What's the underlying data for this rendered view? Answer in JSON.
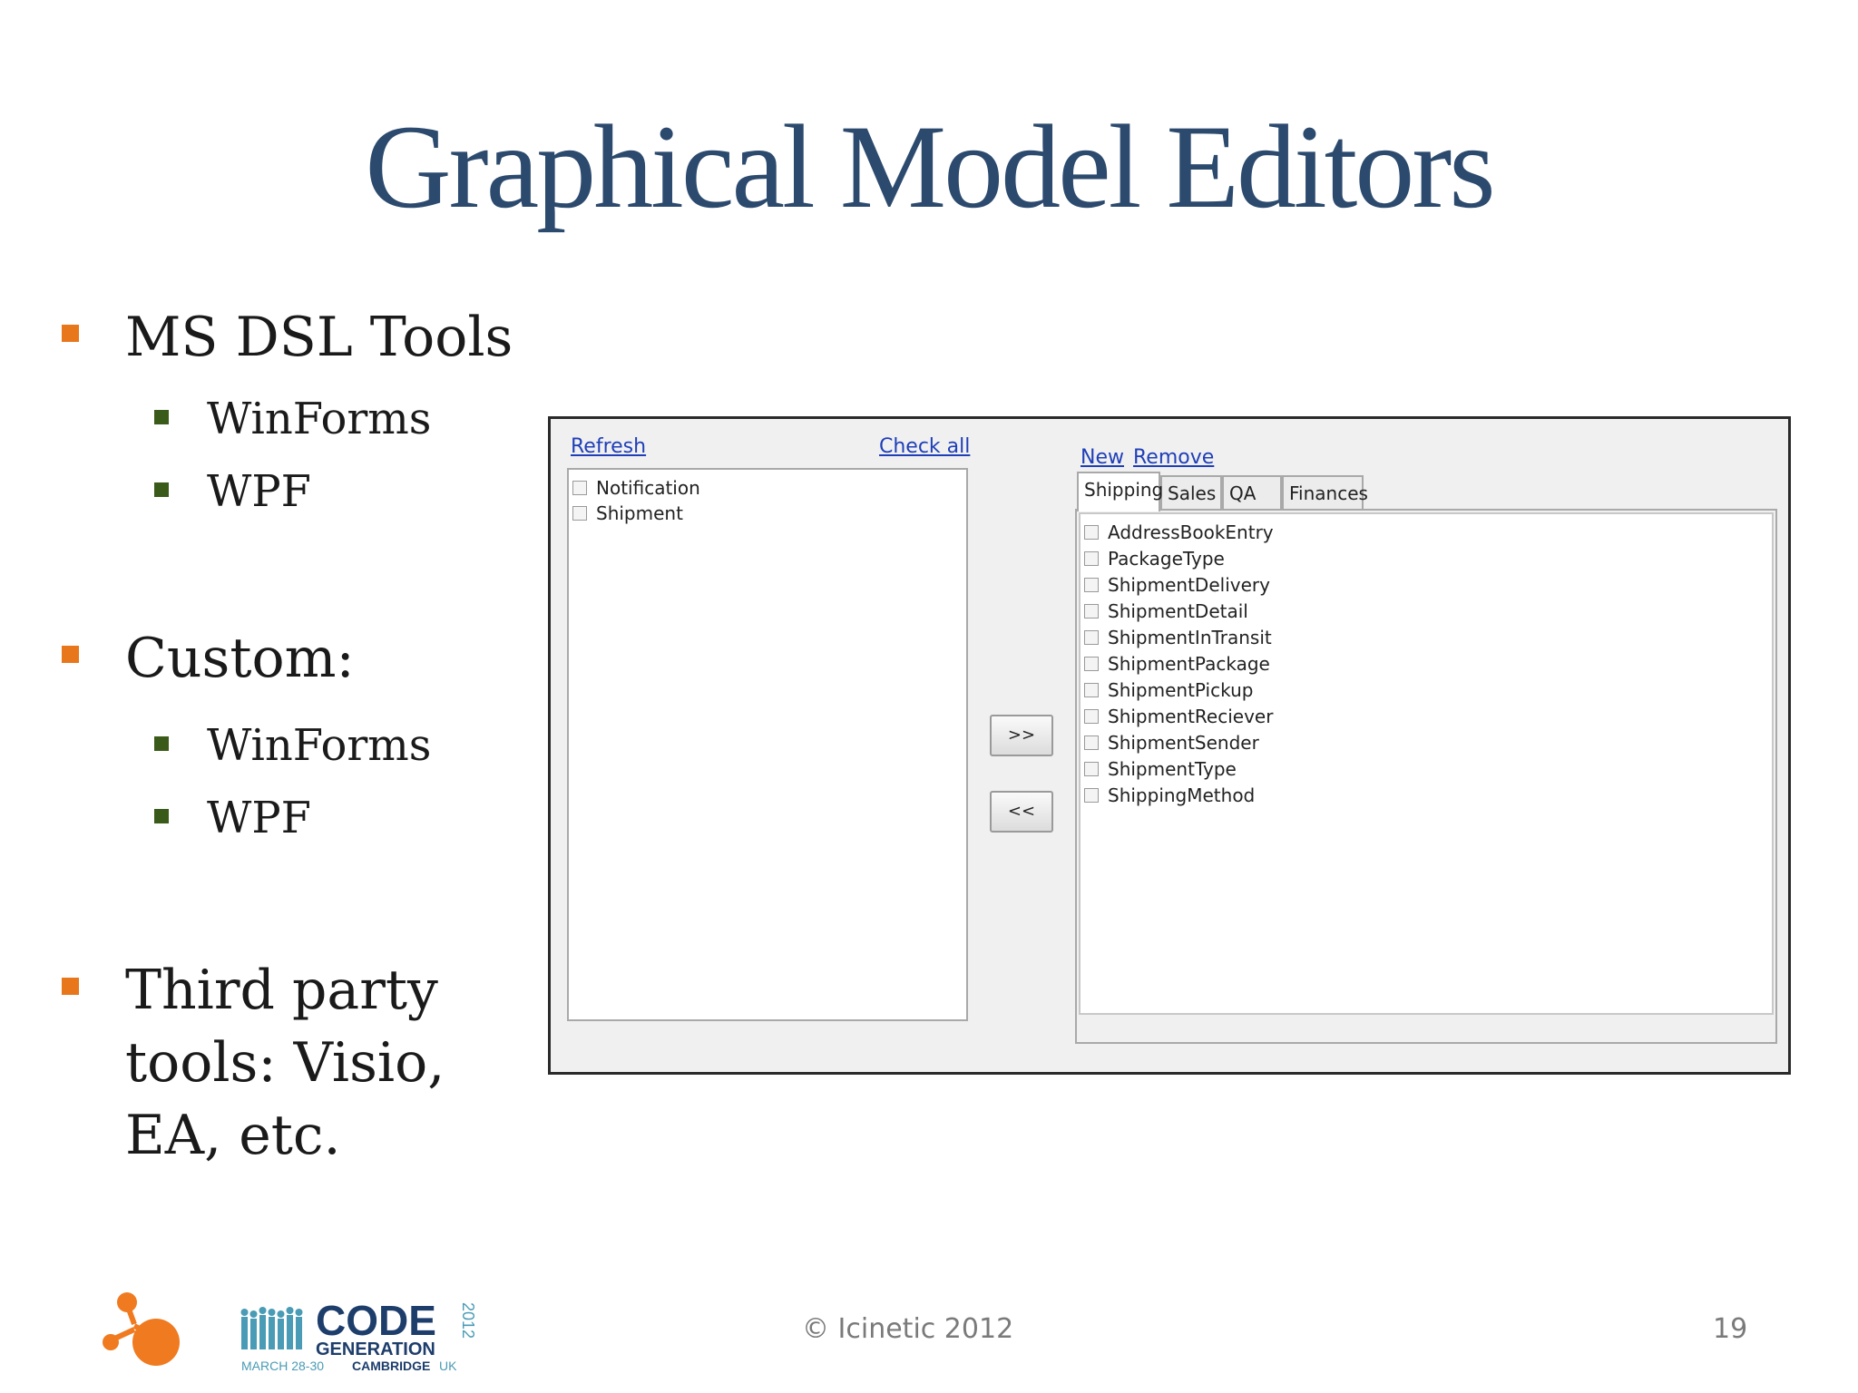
{
  "slide": {
    "title": "Graphical Model Editors",
    "footer": {
      "copyright": "© Icinetic 2012",
      "page_number": "19"
    }
  },
  "bullets": [
    {
      "text": "MS DSL Tools",
      "sub": [
        "WinForms",
        "WPF"
      ]
    },
    {
      "text": "Custom:",
      "sub": [
        "WinForms",
        "WPF"
      ]
    },
    {
      "lines": [
        "Third party",
        "tools: Visio,",
        "EA, etc."
      ]
    }
  ],
  "editor": {
    "left_panel": {
      "refresh_label": "Refresh",
      "check_all_label": "Check all",
      "items": [
        "Notification",
        "Shipment"
      ]
    },
    "move_right_label": ">>",
    "move_left_label": "<<",
    "right_panel": {
      "new_label": "New",
      "remove_label": "Remove",
      "tabs": [
        "Shipping",
        "Sales",
        "QA",
        "Finances"
      ],
      "active_tab": "Shipping",
      "items": [
        "AddressBookEntry",
        "PackageType",
        "ShipmentDelivery",
        "ShipmentDetail",
        "ShipmentInTransit",
        "ShipmentPackage",
        "ShipmentPickup",
        "ShipmentReciever",
        "ShipmentSender",
        "ShipmentType",
        "ShippingMethod"
      ]
    }
  },
  "logos": {
    "code_generation": {
      "line1": "CODE",
      "line2": "GENERATION",
      "line3a": "MARCH 28-30",
      "line3b": "CAMBRIDGE",
      "line3c": "UK",
      "year": "2012"
    }
  },
  "colors": {
    "title": "#2c4a6e",
    "bullet_level1": "#e8761b",
    "bullet_level2": "#3a5a1a",
    "link": "#1f3fb8",
    "icinetic_orange": "#f07a1f",
    "cg_teal": "#4a9bb5",
    "cg_navy": "#1d3d6b"
  }
}
